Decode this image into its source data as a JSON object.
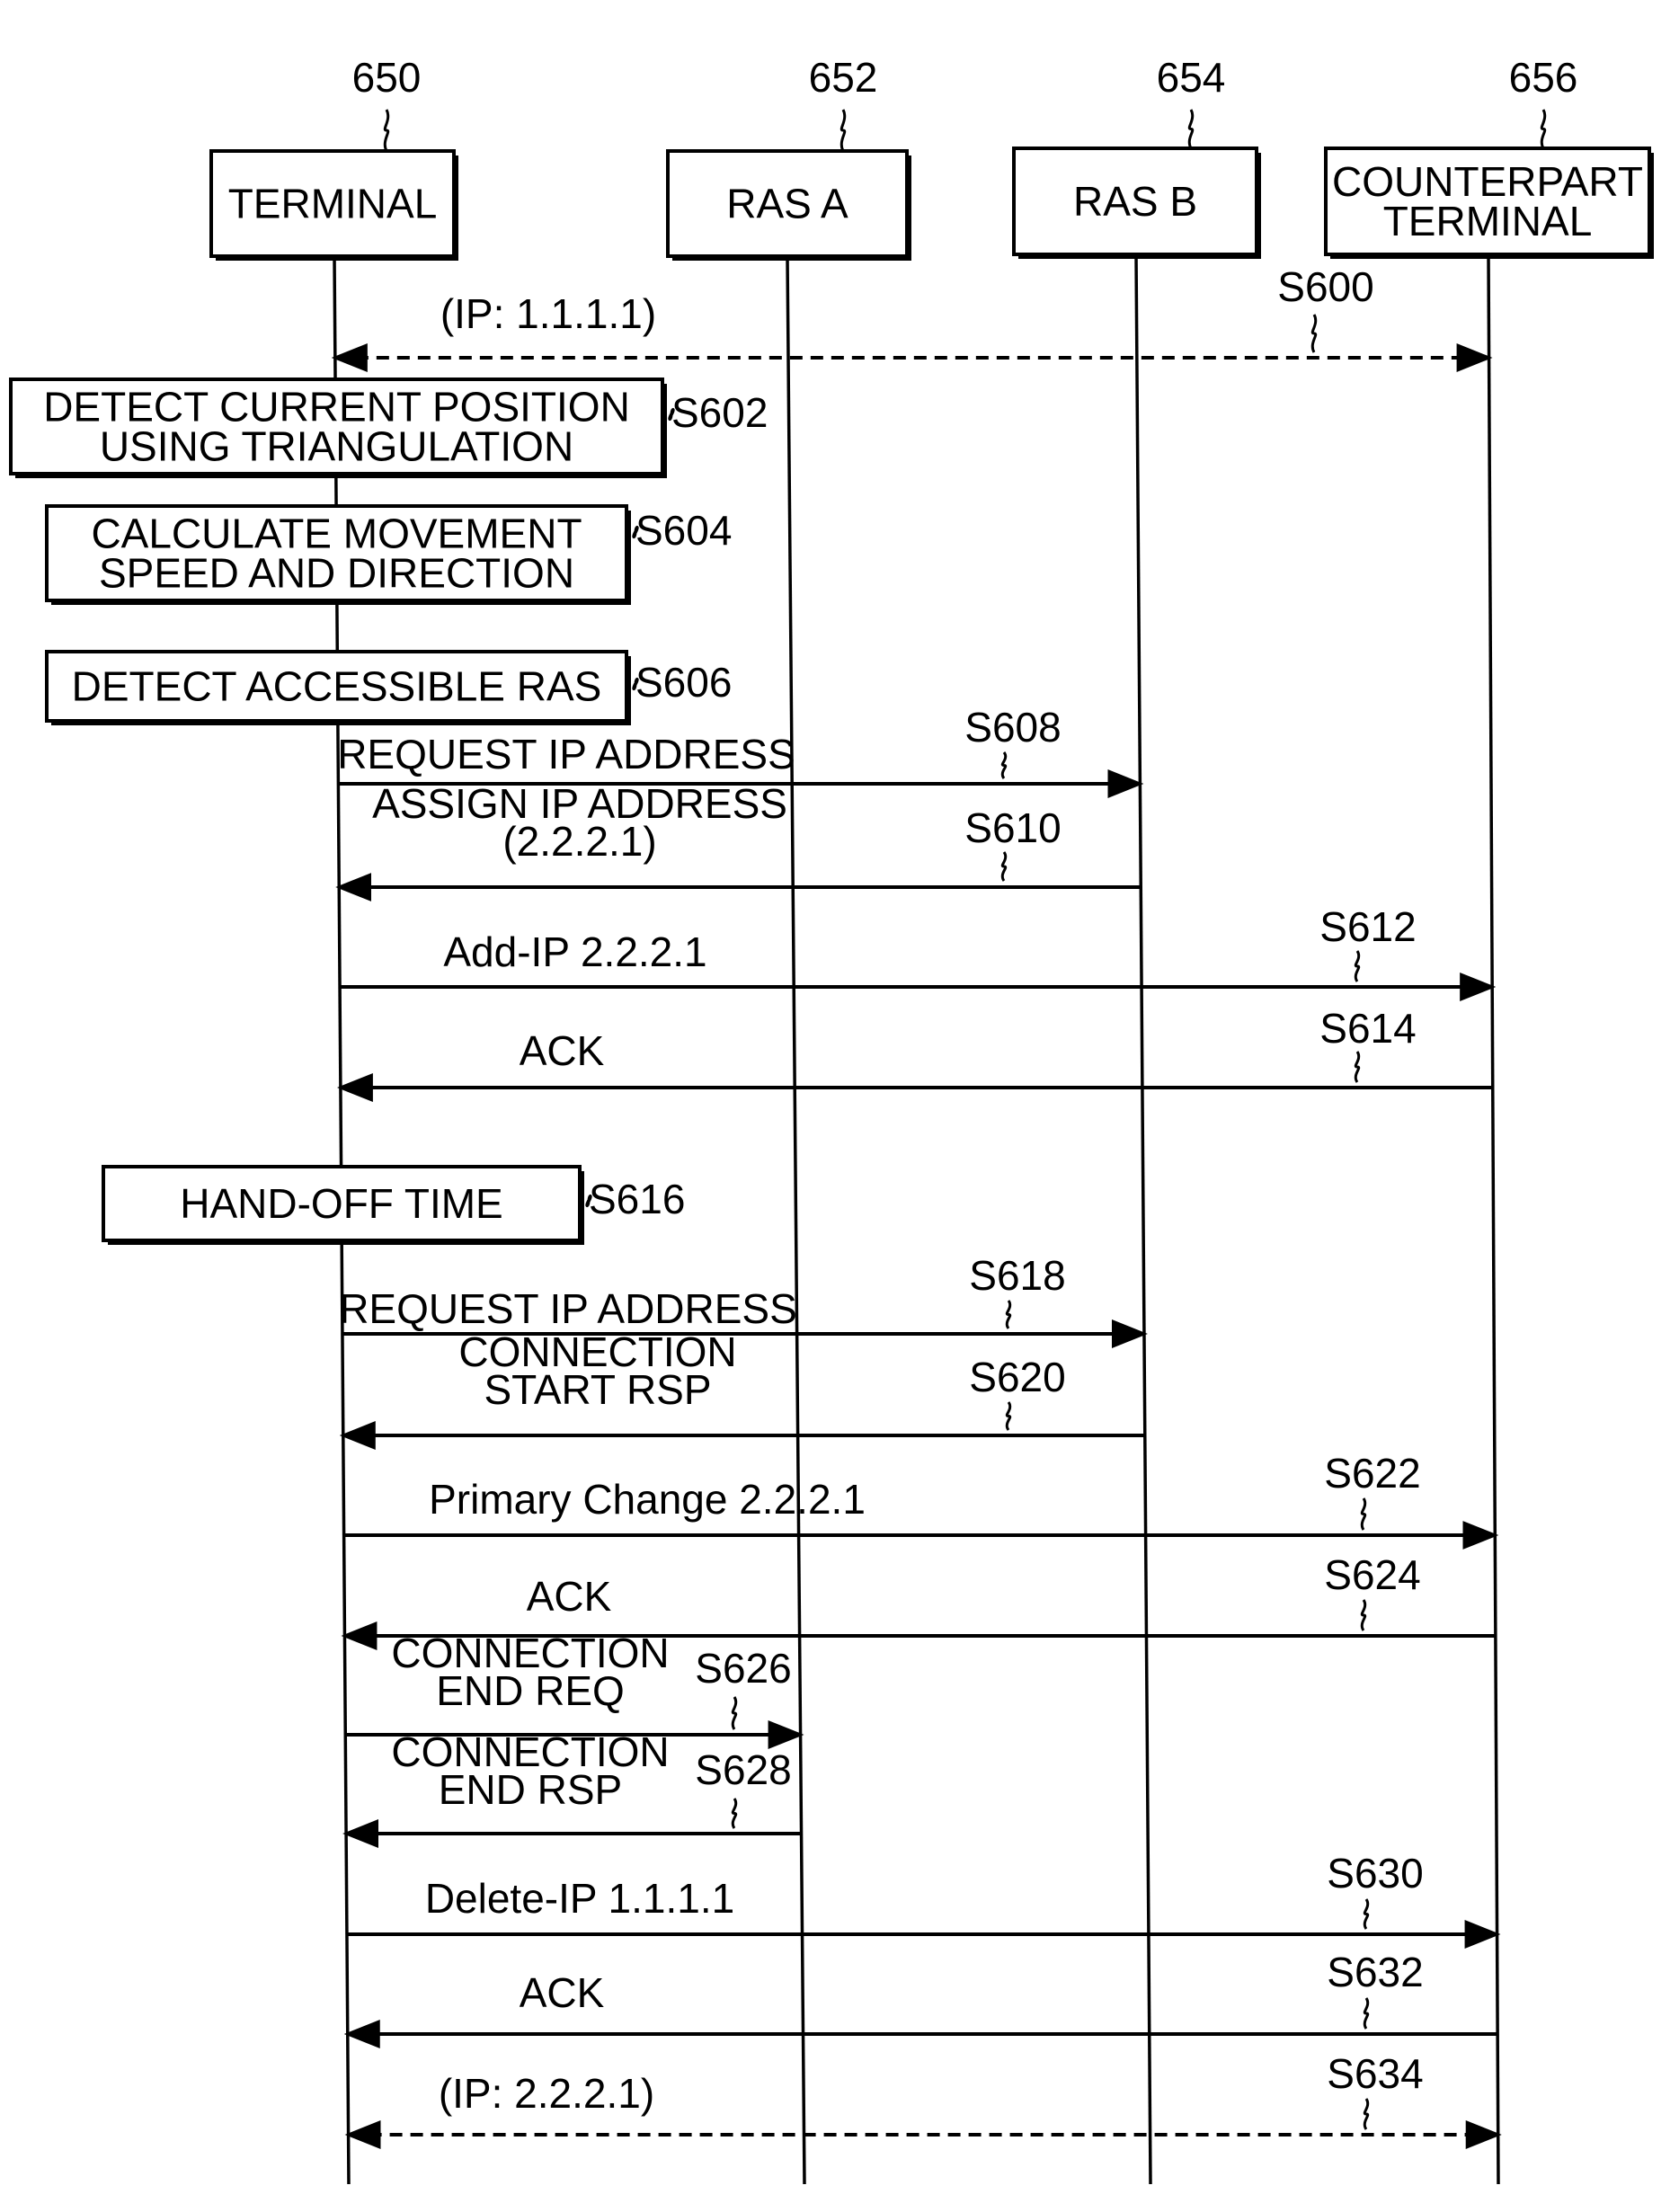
{
  "diagram": {
    "type": "sequence-diagram",
    "lifelines": [
      {
        "id": "terminal",
        "ref": "650",
        "label": [
          "TERMINAL"
        ]
      },
      {
        "id": "ras_a",
        "ref": "652",
        "label": [
          "RAS A"
        ]
      },
      {
        "id": "ras_b",
        "ref": "654",
        "label": [
          "RAS B"
        ]
      },
      {
        "id": "counterpart",
        "ref": "656",
        "label": [
          "COUNTERPART",
          "TERMINAL"
        ]
      }
    ],
    "steps": [
      {
        "step": "S600",
        "kind": "dashed-bidirectional",
        "from": "terminal",
        "to": "counterpart",
        "label": [
          "(IP: 1.1.1.1)"
        ]
      },
      {
        "step": "S602",
        "kind": "process",
        "on": "terminal",
        "label": [
          "DETECT CURRENT POSITION",
          "USING TRIANGULATION"
        ]
      },
      {
        "step": "S604",
        "kind": "process",
        "on": "terminal",
        "label": [
          "CALCULATE MOVEMENT",
          "SPEED AND DIRECTION"
        ]
      },
      {
        "step": "S606",
        "kind": "process",
        "on": "terminal",
        "label": [
          "DETECT ACCESSIBLE RAS"
        ]
      },
      {
        "step": "S608",
        "kind": "message",
        "from": "terminal",
        "to": "ras_b",
        "label": [
          "REQUEST IP ADDRESS"
        ]
      },
      {
        "step": "S610",
        "kind": "message",
        "from": "ras_b",
        "to": "terminal",
        "label": [
          "ASSIGN IP ADDRESS",
          "(2.2.2.1)"
        ]
      },
      {
        "step": "S612",
        "kind": "message",
        "from": "terminal",
        "to": "counterpart",
        "label": [
          "Add-IP 2.2.2.1"
        ]
      },
      {
        "step": "S614",
        "kind": "message",
        "from": "counterpart",
        "to": "terminal",
        "label": [
          "ACK"
        ]
      },
      {
        "step": "S616",
        "kind": "process",
        "on": "terminal",
        "label": [
          "HAND-OFF TIME"
        ]
      },
      {
        "step": "S618",
        "kind": "message",
        "from": "terminal",
        "to": "ras_b",
        "label": [
          "REQUEST IP ADDRESS"
        ]
      },
      {
        "step": "S620",
        "kind": "message",
        "from": "ras_b",
        "to": "terminal",
        "label": [
          "CONNECTION",
          "START RSP"
        ]
      },
      {
        "step": "S622",
        "kind": "message",
        "from": "terminal",
        "to": "counterpart",
        "label": [
          "Primary Change 2.2.2.1"
        ]
      },
      {
        "step": "S624",
        "kind": "message",
        "from": "counterpart",
        "to": "terminal",
        "label": [
          "ACK"
        ]
      },
      {
        "step": "S626",
        "kind": "message",
        "from": "terminal",
        "to": "ras_a",
        "label": [
          "CONNECTION",
          "END REQ"
        ]
      },
      {
        "step": "S628",
        "kind": "message",
        "from": "ras_a",
        "to": "terminal",
        "label": [
          "CONNECTION",
          "END RSP"
        ]
      },
      {
        "step": "S630",
        "kind": "message",
        "from": "terminal",
        "to": "counterpart",
        "label": [
          "Delete-IP 1.1.1.1"
        ]
      },
      {
        "step": "S632",
        "kind": "message",
        "from": "counterpart",
        "to": "terminal",
        "label": [
          "ACK"
        ]
      },
      {
        "step": "S634",
        "kind": "dashed-bidirectional",
        "from": "terminal",
        "to": "counterpart",
        "label": [
          "(IP: 2.2.2.1)"
        ]
      }
    ]
  }
}
